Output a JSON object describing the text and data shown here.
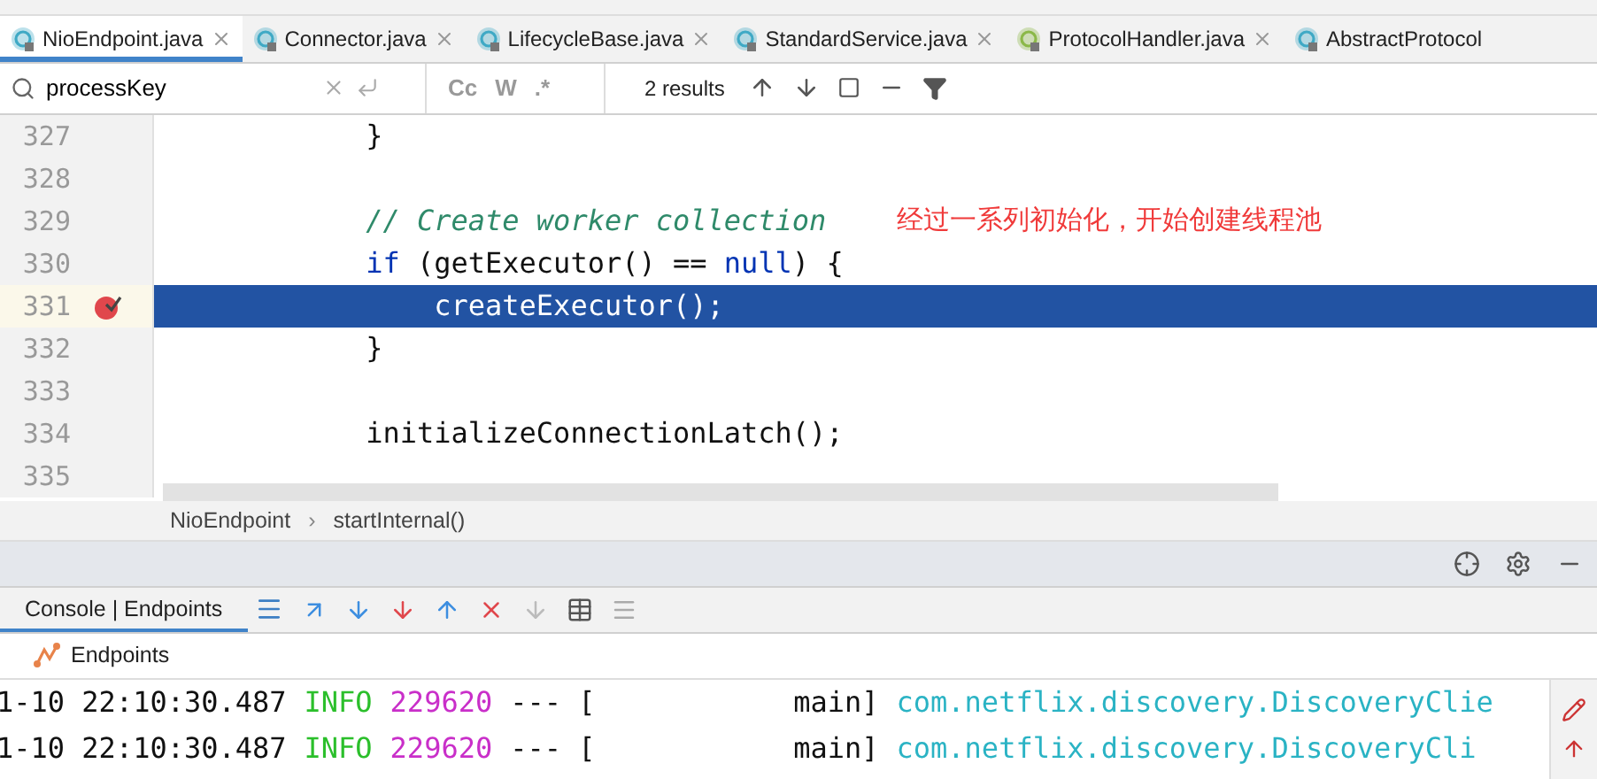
{
  "tabs": [
    {
      "label": "NioEndpoint.java",
      "kind": "class",
      "selected": true
    },
    {
      "label": "Connector.java",
      "kind": "class",
      "selected": false
    },
    {
      "label": "LifecycleBase.java",
      "kind": "class",
      "selected": false
    },
    {
      "label": "StandardService.java",
      "kind": "class",
      "selected": false
    },
    {
      "label": "ProtocolHandler.java",
      "kind": "interface",
      "selected": false
    },
    {
      "label": "AbstractProtocol",
      "kind": "class",
      "selected": false
    }
  ],
  "search": {
    "value": "processKey",
    "case_label": "Cc",
    "word_label": "W",
    "regex_label": ".*",
    "results": "2 results"
  },
  "code": [
    {
      "number": "327",
      "tokens": [
        {
          "kind": "plain",
          "text": "            }"
        }
      ],
      "breakpoint": false,
      "current": false
    },
    {
      "number": "328",
      "breakpoint": false,
      "current": false
    },
    {
      "number": "329",
      "tokens": [
        {
          "kind": "comment",
          "text": "            // Create worker collection"
        }
      ],
      "note": "经过一系列初始化，开始创建线程池",
      "breakpoint": false,
      "current": false
    },
    {
      "number": "330",
      "tokens": [
        {
          "kind": "keyword",
          "text": "            if"
        },
        {
          "kind": "plain",
          "text": " (getExecutor() == "
        },
        {
          "kind": "keyword",
          "text": "null"
        },
        {
          "kind": "plain",
          "text": ") {"
        }
      ],
      "breakpoint": false,
      "current": false
    },
    {
      "number": "331",
      "tokens": [
        {
          "kind": "plain",
          "text": "                createExecutor();"
        }
      ],
      "breakpoint": true,
      "current": true
    },
    {
      "number": "332",
      "tokens": [
        {
          "kind": "plain",
          "text": "            }"
        }
      ],
      "breakpoint": false,
      "current": false
    },
    {
      "number": "333",
      "breakpoint": false,
      "current": false
    },
    {
      "number": "334",
      "tokens": [
        {
          "kind": "plain",
          "text": "            initializeConnectionLatch();"
        }
      ],
      "breakpoint": false,
      "current": false
    },
    {
      "number": "335",
      "breakpoint": false,
      "current": false
    }
  ],
  "breadcrumb": {
    "items": [
      "NioEndpoint",
      "startInternal()"
    ],
    "separator": "›"
  },
  "console": {
    "tab": "Console | Endpoints",
    "tree_item": "Endpoints",
    "log": [
      {
        "time": "1-10 22:10:30.487",
        "level": "INFO",
        "pid": "229620",
        "sep": "--- [",
        "thread": "main]",
        "logger": "com.netflix.discovery.DiscoveryClie"
      },
      {
        "time": "1-10 22:10:30.487",
        "level": "INFO",
        "pid": "229620",
        "sep": "--- [",
        "thread": "main]",
        "logger": "com.netflix.discovery.DiscoveryCli"
      }
    ]
  }
}
